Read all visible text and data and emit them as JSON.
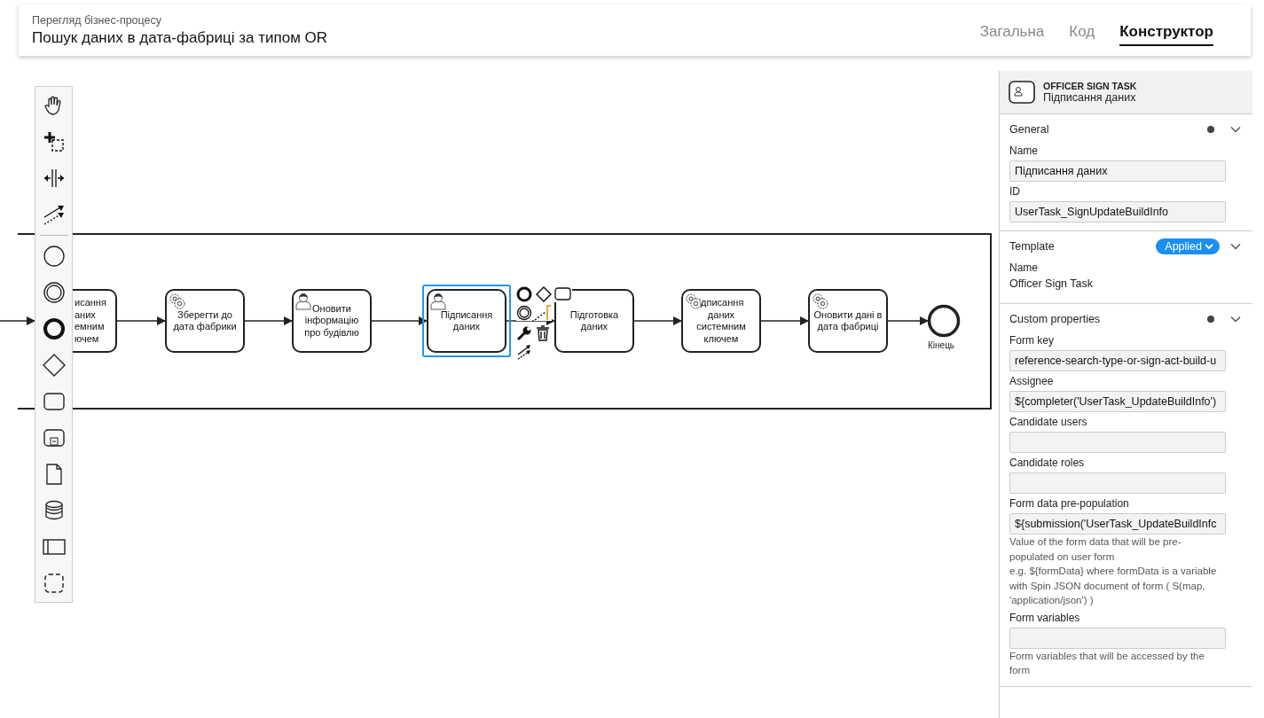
{
  "header": {
    "subtitle": "Перегляд бізнес-процесу",
    "title": "Пошук даних в дата-фабриці за типом OR"
  },
  "tabs": [
    {
      "label": "Загальна",
      "selected": false
    },
    {
      "label": "Код",
      "selected": false
    },
    {
      "label": "Конструктор",
      "selected": true
    }
  ],
  "diagram": {
    "tasks": [
      {
        "kind": "task",
        "label": "исання\nаних\nемним\nючем",
        "selected": false
      },
      {
        "kind": "service",
        "label": "Зберегти до\nдата фабрики",
        "selected": false
      },
      {
        "kind": "user",
        "label": "Оновити\nінформацію\nпро будівлю",
        "selected": false
      },
      {
        "kind": "user",
        "label": "Підписання\nданих",
        "selected": true
      },
      {
        "kind": "task",
        "label": "Підготовка\nданих",
        "selected": false
      },
      {
        "kind": "service",
        "label": "ідписання\nданих\nсистемним\nключем",
        "selected": false
      },
      {
        "kind": "service",
        "label": "Оновити дані в\nдата фабриці",
        "selected": false
      }
    ],
    "end_event": {
      "label": "Кінець"
    }
  },
  "properties": {
    "element_type": "OFFICER SIGN TASK",
    "element_name": "Підписання даних",
    "sections": [
      {
        "title": "General",
        "changed": true,
        "entries": [
          {
            "kind": "input",
            "label": "Name",
            "value": "Підписання даних"
          },
          {
            "kind": "input",
            "label": "ID",
            "value": "UserTask_SignUpdateBuildInfo"
          }
        ]
      },
      {
        "title": "Template",
        "changed": false,
        "badge": "Applied",
        "entries": [
          {
            "kind": "text",
            "label": "Name",
            "value": "Officer Sign Task"
          }
        ]
      },
      {
        "title": "Custom properties",
        "changed": true,
        "entries": [
          {
            "kind": "input",
            "label": "Form key",
            "value": "reference-search-type-or-sign-act-build-u"
          },
          {
            "kind": "input",
            "label": "Assignee",
            "value": "${completer('UserTask_UpdateBuildInfo')"
          },
          {
            "kind": "input",
            "label": "Candidate users"
          },
          {
            "kind": "input",
            "label": "Candidate roles"
          },
          {
            "kind": "input",
            "label": "Form data pre-population",
            "value": "${submission('UserTask_UpdateBuildInfc",
            "description": "Value of the form data that will be pre-populated on user form",
            "example": "e.g. ${formData} where formData is a variable with Spin JSON document of form ( S(map, 'application/json') )"
          },
          {
            "kind": "input",
            "label": "Form variables",
            "description": "Form variables that will be accessed by the form"
          }
        ]
      }
    ]
  }
}
